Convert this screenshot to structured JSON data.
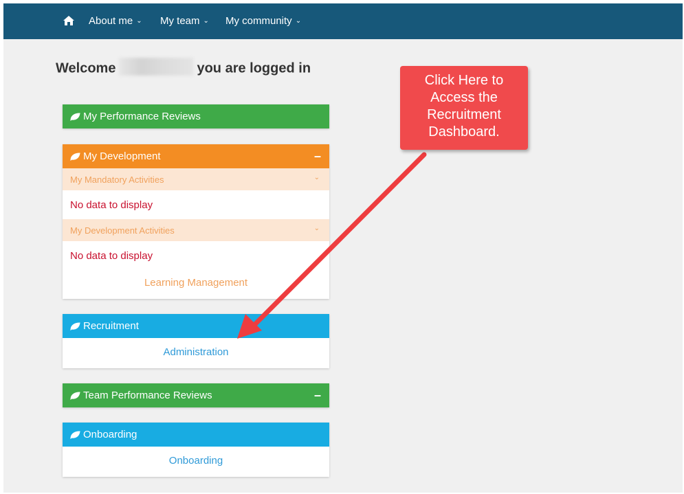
{
  "nav": {
    "items": [
      {
        "label": "About me"
      },
      {
        "label": "My team"
      },
      {
        "label": "My community"
      }
    ]
  },
  "welcome": {
    "prefix": "Welcome",
    "suffix": "you are logged in"
  },
  "panels": {
    "performance": {
      "title": "My Performance Reviews"
    },
    "development": {
      "title": "My Development",
      "collapse": "–",
      "mandatory_label": "My Mandatory Activities",
      "mandatory_empty": "No data to display",
      "activities_label": "My Development Activities",
      "activities_empty": "No data to display",
      "link": "Learning Management"
    },
    "recruitment": {
      "title": "Recruitment",
      "link": "Administration"
    },
    "team_reviews": {
      "title": "Team Performance Reviews",
      "collapse": "–"
    },
    "onboarding": {
      "title": "Onboarding",
      "link": "Onboarding"
    }
  },
  "callout": {
    "lines": [
      "Click Here to",
      "Access the",
      "Recruitment",
      "Dashboard."
    ]
  },
  "colors": {
    "nav_bg": "#17587a",
    "green": "#3faa48",
    "orange": "#f38d23",
    "blue": "#18ace2",
    "callout": "#f04a4c"
  }
}
